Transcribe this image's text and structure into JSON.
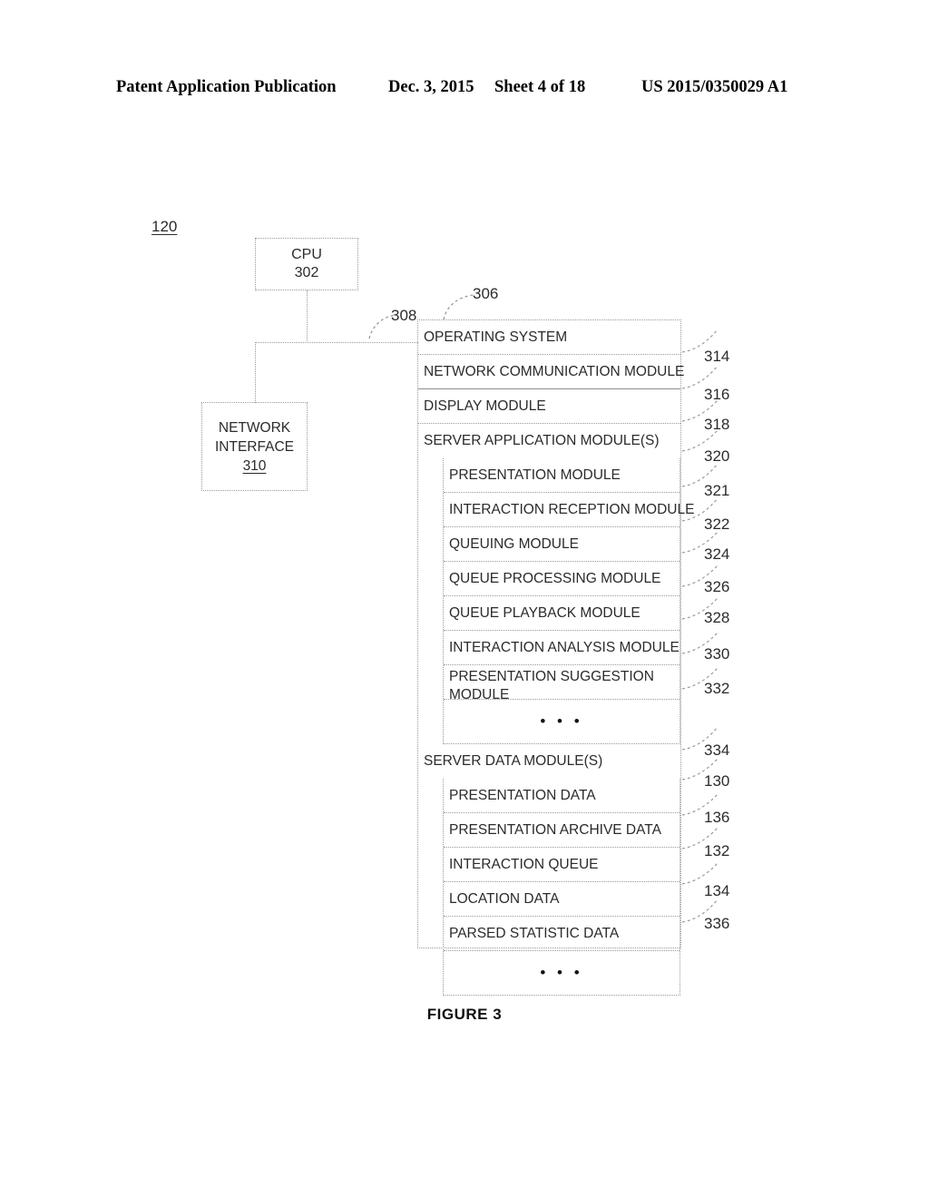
{
  "header": {
    "title": "Patent Application Publication",
    "date": "Dec. 3, 2015",
    "sheet": "Sheet 4 of 18",
    "number": "US 2015/0350029 A1"
  },
  "figure": {
    "system_ref": "120",
    "caption": "FIGURE 3"
  },
  "cpu": {
    "label": "CPU",
    "ref": "302"
  },
  "network_interface": {
    "line1": "NETWORK",
    "line2": "INTERFACE",
    "ref": "310"
  },
  "callouts": {
    "memory": "306",
    "bus": "308"
  },
  "memory": {
    "rows": [
      {
        "label": "OPERATING SYSTEM",
        "ref": "314"
      },
      {
        "label": "NETWORK COMMUNICATION MODULE",
        "ref": "316"
      },
      {
        "label": "DISPLAY MODULE",
        "ref": "318"
      },
      {
        "label": "SERVER APPLICATION MODULE(S)",
        "ref": "320"
      }
    ],
    "application_modules": [
      {
        "label": "PRESENTATION MODULE",
        "ref": "321"
      },
      {
        "label": "INTERACTION RECEPTION MODULE",
        "ref": "322"
      },
      {
        "label": "QUEUING MODULE",
        "ref": "324"
      },
      {
        "label": "QUEUE PROCESSING MODULE",
        "ref": "326"
      },
      {
        "label": "QUEUE PLAYBACK MODULE",
        "ref": "328"
      },
      {
        "label": "INTERACTION ANALYSIS MODULE",
        "ref": "330"
      },
      {
        "label": "PRESENTATION SUGGESTION MODULE",
        "ref": "332"
      },
      {
        "label": "• • •",
        "ref": ""
      }
    ],
    "data_header": {
      "label": "SERVER DATA MODULE(S)",
      "ref": "334"
    },
    "data_modules": [
      {
        "label": "PRESENTATION DATA",
        "ref": "130"
      },
      {
        "label": "PRESENTATION ARCHIVE DATA",
        "ref": "136"
      },
      {
        "label": "INTERACTION QUEUE",
        "ref": "132"
      },
      {
        "label": "LOCATION DATA",
        "ref": "134"
      },
      {
        "label": "PARSED STATISTIC DATA",
        "ref": "336"
      },
      {
        "label": "• • •",
        "ref": ""
      }
    ]
  },
  "refnums": {
    "r314": "314",
    "r316": "316",
    "r318": "318",
    "r320": "320",
    "r321": "321",
    "r322": "322",
    "r324": "324",
    "r326": "326",
    "r328": "328",
    "r330": "330",
    "r332": "332",
    "r334": "334",
    "r130": "130",
    "r136": "136",
    "r132": "132",
    "r134": "134",
    "r336": "336"
  },
  "colors": {
    "line": "#9a9a9a",
    "text": "#2b2b2b",
    "ink": "#000000"
  }
}
